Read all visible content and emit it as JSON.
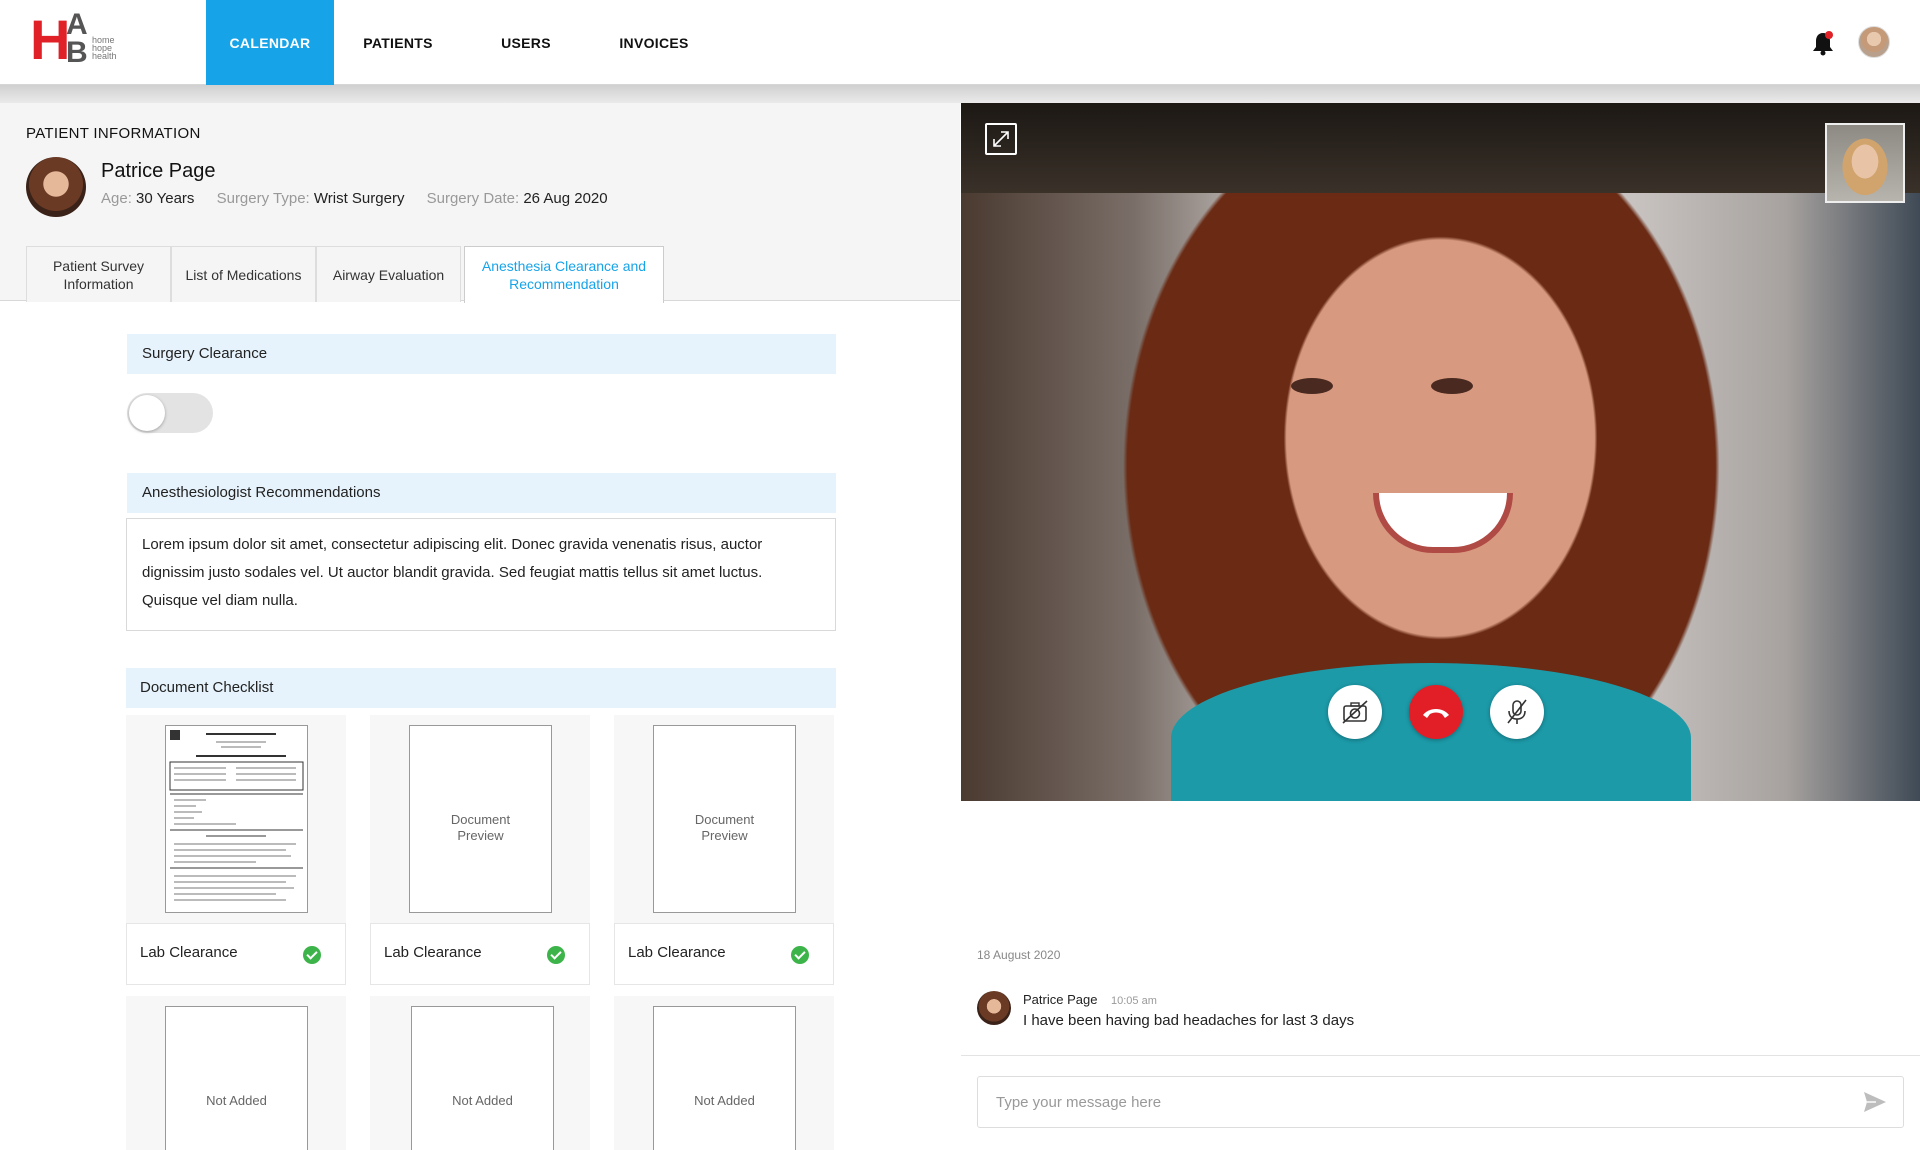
{
  "brand": {
    "logo_letter_h": "H",
    "logo_letter_a": "A",
    "logo_letter_b": "B",
    "logo_tagline": "home hope health",
    "primary_color": "#e02127",
    "accent_color": "#17a3e8"
  },
  "nav": {
    "items": [
      {
        "label": "CALENDAR",
        "active": true
      },
      {
        "label": "PATIENTS",
        "active": false
      },
      {
        "label": "USERS",
        "active": false
      },
      {
        "label": "INVOICES",
        "active": false
      }
    ]
  },
  "header_icons": [
    "bell-icon",
    "user-avatar"
  ],
  "patient": {
    "section_title": "PATIENT INFORMATION",
    "name": "Patrice Page",
    "age_label": "Age:",
    "age_value": "30 Years",
    "surgery_type_label": "Surgery Type:",
    "surgery_type_value": "Wrist Surgery",
    "surgery_date_label": "Surgery Date:",
    "surgery_date_value": "26 Aug 2020"
  },
  "tabs": [
    {
      "label": "Patient Survey Information",
      "active": false
    },
    {
      "label": "List of Medications",
      "active": false
    },
    {
      "label": "Airway Evaluation",
      "active": false
    },
    {
      "label": "Anesthesia Clearance and Recommendation",
      "active": true
    }
  ],
  "surgery_clearance": {
    "title": "Surgery Clearance",
    "toggle_on": false
  },
  "recommendations": {
    "title": "Anesthesiologist  Recommendations",
    "text": "Lorem ipsum dolor sit amet, consectetur adipiscing elit. Donec gravida venenatis risus, auctor dignissim justo sodales vel. Ut auctor blandit gravida. Sed feugiat mattis tellus sit amet luctus. Quisque vel diam nulla."
  },
  "document_checklist": {
    "title": "Document Checklist",
    "documents": [
      {
        "label": "Lab Clearance",
        "preview": "",
        "checked": true
      },
      {
        "label": "Lab Clearance",
        "preview": "Document Preview",
        "checked": true
      },
      {
        "label": "Lab Clearance",
        "preview": "Document Preview",
        "checked": true
      },
      {
        "label": "",
        "preview": "Not Added",
        "checked": false
      },
      {
        "label": "",
        "preview": "Not Added",
        "checked": false
      },
      {
        "label": "",
        "preview": "Not Added",
        "checked": false
      }
    ]
  },
  "video_call": {
    "controls": [
      "camera-off-icon",
      "end-call-icon",
      "mute-mic-icon"
    ],
    "end_call_color": "#e21f26"
  },
  "chat": {
    "date": "18 August 2020",
    "messages": [
      {
        "sender": "Patrice Page",
        "time": "10:05 am",
        "text": "I have been having bad headaches for last 3 days"
      }
    ],
    "input_placeholder": "Type your message here"
  }
}
